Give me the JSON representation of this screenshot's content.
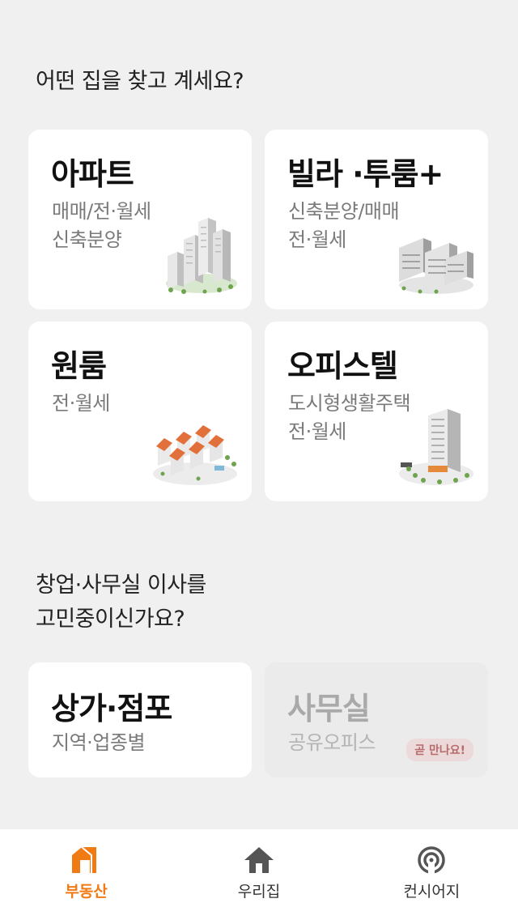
{
  "header": {
    "title": "어떤 집을 찾고 계세요?"
  },
  "residential_cards": [
    {
      "title": "아파트",
      "sub1": "매매/전·월세",
      "sub2": "신축분양",
      "icon": "apartment-complex-illustration"
    },
    {
      "title": "빌라 ·투룸+",
      "sub1": "신축분양/매매",
      "sub2": "전·월세",
      "icon": "villa-buildings-illustration"
    },
    {
      "title": "원룸",
      "sub1": "전·월세",
      "sub2": "",
      "icon": "oneroom-houses-illustration"
    },
    {
      "title": "오피스텔",
      "sub1": "도시형생활주택",
      "sub2": "전·월세",
      "icon": "officetel-tower-illustration"
    }
  ],
  "business_section": {
    "title_line1": "창업·사무실 이사를",
    "title_line2": "고민중이신가요?"
  },
  "business_cards": [
    {
      "title": "상가·점포",
      "sub1": "지역·업종별"
    },
    {
      "title": "사무실",
      "sub1": "공유오피스",
      "badge": "곧 만나요!"
    }
  ],
  "tabbar": {
    "items": [
      {
        "label": "부동산",
        "icon": "real-estate-icon",
        "active": true
      },
      {
        "label": "우리집",
        "icon": "home-icon",
        "active": false
      },
      {
        "label": "컨시어지",
        "icon": "concierge-icon",
        "active": false
      }
    ]
  },
  "colors": {
    "accent": "#f07a14",
    "background": "#f0f0f0",
    "card": "#ffffff",
    "badge_text": "#b86b6b"
  }
}
